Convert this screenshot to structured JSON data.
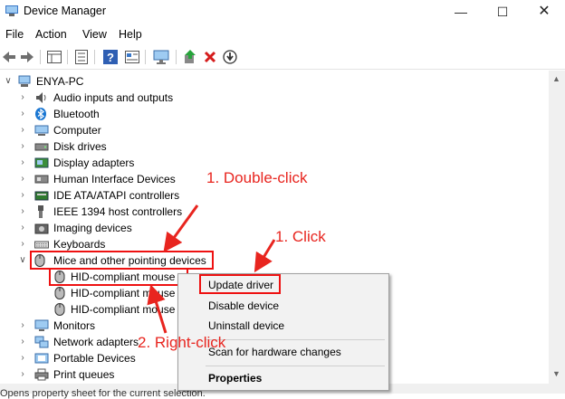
{
  "window": {
    "title": "Device Manager",
    "minimize_icon": "minimize-icon",
    "maximize_icon": "maximize-icon",
    "close_icon": "close-icon"
  },
  "menu": [
    "File",
    "Action",
    "View",
    "Help"
  ],
  "toolbar_icons": [
    "back-arrow-icon",
    "forward-arrow-icon",
    "properties-grid-icon",
    "list-icon",
    "help-icon",
    "details-icon",
    "monitor-icon",
    "update-driver-icon",
    "uninstall-x-icon",
    "download-icon"
  ],
  "tree": {
    "root": "ENYA-PC",
    "categories": [
      {
        "label": "Audio inputs and outputs",
        "icon": "speaker-icon"
      },
      {
        "label": "Bluetooth",
        "icon": "bluetooth-icon"
      },
      {
        "label": "Computer",
        "icon": "computer-icon"
      },
      {
        "label": "Disk drives",
        "icon": "disk-icon"
      },
      {
        "label": "Display adapters",
        "icon": "display-adapter-icon"
      },
      {
        "label": "Human Interface Devices",
        "icon": "hid-icon"
      },
      {
        "label": "IDE ATA/ATAPI controllers",
        "icon": "ide-controller-icon"
      },
      {
        "label": "IEEE 1394 host controllers",
        "icon": "ieee1394-icon"
      },
      {
        "label": "Imaging devices",
        "icon": "camera-icon"
      },
      {
        "label": "Keyboards",
        "icon": "keyboard-icon"
      },
      {
        "label": "Mice and other pointing devices",
        "icon": "mouse-icon"
      }
    ],
    "mice_children": [
      "HID-compliant mouse",
      "HID-compliant mouse",
      "HID-compliant mouse"
    ],
    "after": [
      {
        "label": "Monitors",
        "icon": "monitor-icon"
      },
      {
        "label": "Network adapters",
        "icon": "network-icon"
      },
      {
        "label": "Portable Devices",
        "icon": "portable-device-icon"
      },
      {
        "label": "Print queues",
        "icon": "printer-icon"
      }
    ]
  },
  "context_menu": {
    "items": [
      "Update driver",
      "Disable device",
      "Uninstall device",
      "Scan for hardware changes",
      "Properties"
    ]
  },
  "annotations": {
    "double_click": "1. Double-click",
    "click": "1. Click",
    "right_click": "2. Right-click",
    "color": "#e8251f"
  },
  "status_text": "Opens property sheet for the current selection."
}
